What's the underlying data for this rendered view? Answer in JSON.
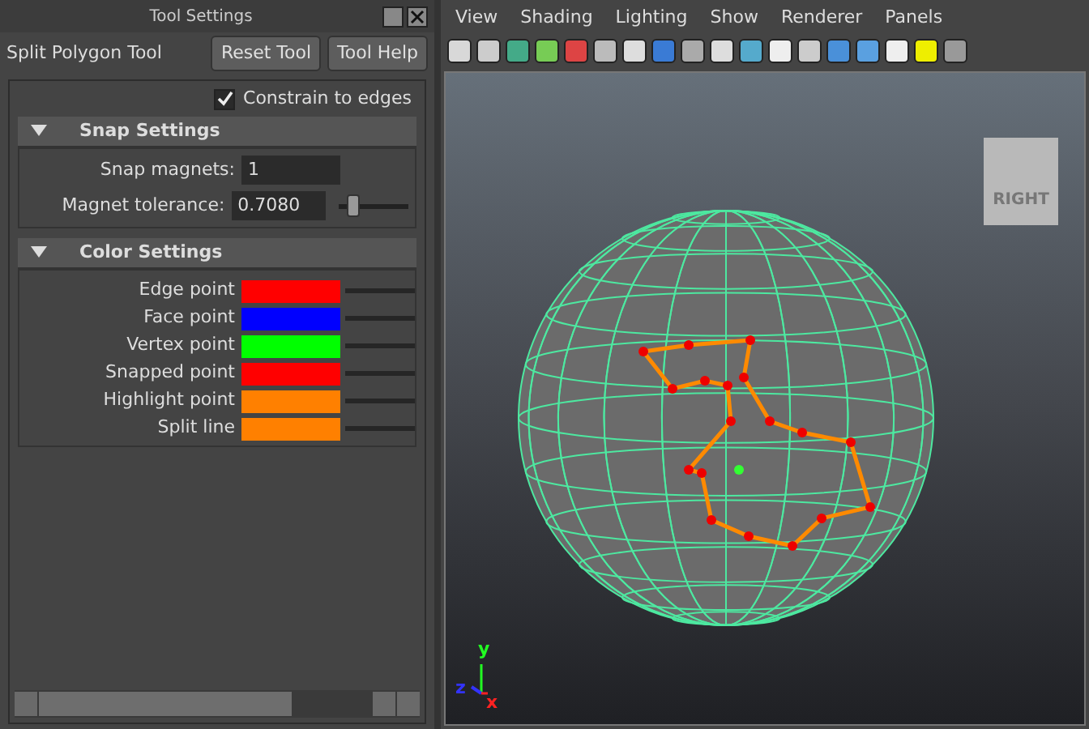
{
  "tool_panel": {
    "title": "Tool Settings",
    "tool_name": "Split Polygon Tool",
    "buttons": [
      "Reset Tool",
      "Tool Help"
    ],
    "constrain": {
      "label": "Constrain to edges",
      "checked": true
    },
    "snap_section": {
      "title": "Snap Settings",
      "expanded": true,
      "fields": [
        {
          "kind": "number",
          "label": "Snap magnets:",
          "value": "1"
        },
        {
          "kind": "slider",
          "label": "Magnet tolerance:",
          "value": "0.7080",
          "level": 0.25
        }
      ]
    },
    "color_section": {
      "title": "Color Settings",
      "expanded": true,
      "colors": [
        {
          "label": "Edge point",
          "color": "#ff0000"
        },
        {
          "label": "Face point",
          "color": "#0000ff"
        },
        {
          "label": "Vertex point",
          "color": "#00ff00"
        },
        {
          "label": "Snapped point",
          "color": "#ff0000"
        },
        {
          "label": "Highlight point",
          "color": "#ff8000"
        },
        {
          "label": "Split line",
          "color": "#ff8000"
        }
      ]
    }
  },
  "viewport": {
    "menu": [
      "View",
      "Shading",
      "Lighting",
      "Show",
      "Renderer",
      "Panels"
    ],
    "view_cube": "RIGHT",
    "axes": [
      "y",
      "x",
      "z"
    ]
  }
}
